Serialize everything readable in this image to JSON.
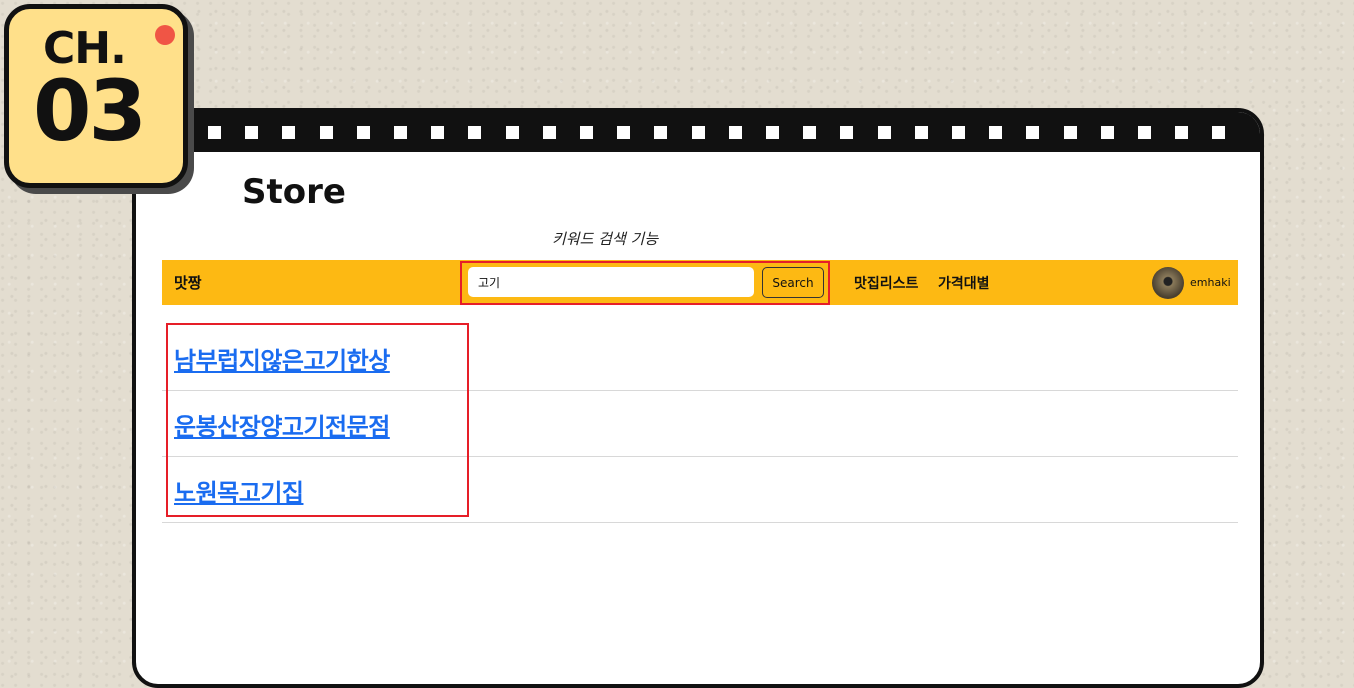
{
  "badge": {
    "chapter_label": "CH.",
    "chapter_number": "03"
  },
  "slide": {
    "title": "Store",
    "caption": "키워드 검색 기능"
  },
  "navbar": {
    "brand": "맛짱",
    "search": {
      "value": "고기",
      "button_label": "Search"
    },
    "links": [
      "맛집리스트",
      "가격대별"
    ],
    "user": {
      "name": "emhaki"
    }
  },
  "results": [
    {
      "name": "남부럽지않은고기한상"
    },
    {
      "name": "운봉산장양고기전문점"
    },
    {
      "name": "노원목고기집"
    }
  ],
  "colors": {
    "navbar": "#fdb913",
    "link": "#1a6cf0",
    "highlight": "#e61e28",
    "badge": "#ffe08a"
  }
}
